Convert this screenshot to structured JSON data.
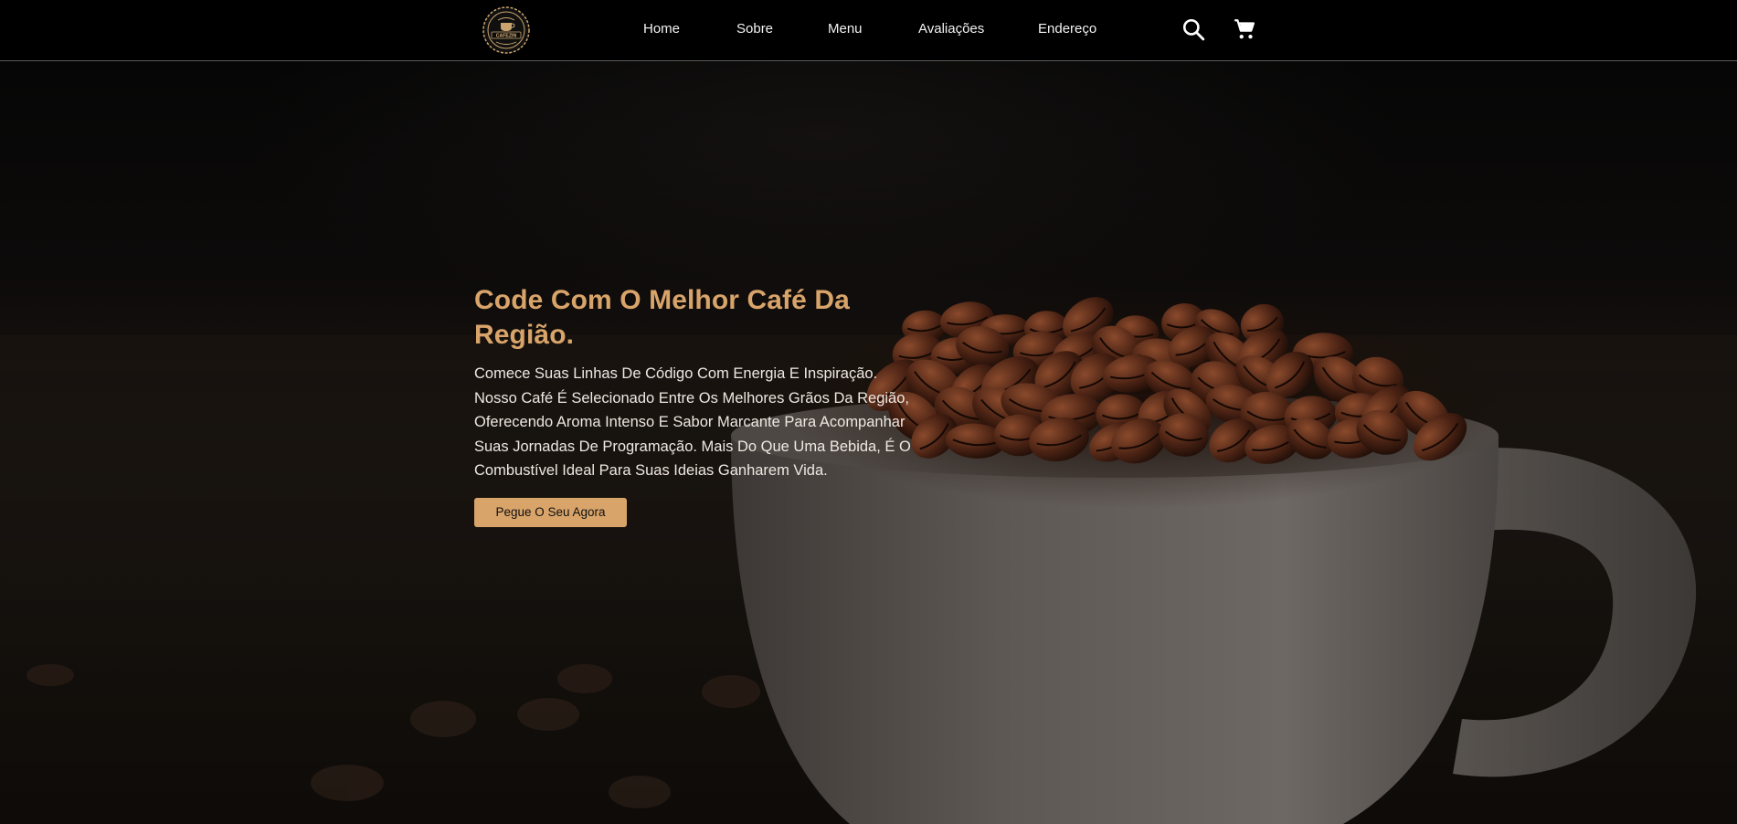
{
  "brand": {
    "logo_icon": "coffee-badge-logo",
    "logo_text": "CAFEZIN"
  },
  "nav": {
    "items": [
      {
        "label": "Home"
      },
      {
        "label": "Sobre"
      },
      {
        "label": "Menu"
      },
      {
        "label": "Avaliações"
      },
      {
        "label": "Endereço"
      }
    ],
    "search_icon": "search-icon",
    "cart_icon": "cart-icon"
  },
  "hero": {
    "title": "Code Com O Melhor Café Da Região.",
    "description": "Comece Suas Linhas De Código Com Energia E Inspiração. Nosso Café É Selecionado Entre Os Melhores Grãos Da Região, Oferecendo Aroma Intenso E Sabor Marcante Para Acompanhar Suas Jornadas De Programação. Mais Do Que Uma Bebida, É O Combustível Ideal Para Suas Ideias Ganharem Vida.",
    "button_label": "Pegue O Seu Agora"
  },
  "colors": {
    "accent": "#d8a46a",
    "background": "#000000",
    "nav_text": "#f2f2f2",
    "hero_text": "#efe8e2"
  }
}
